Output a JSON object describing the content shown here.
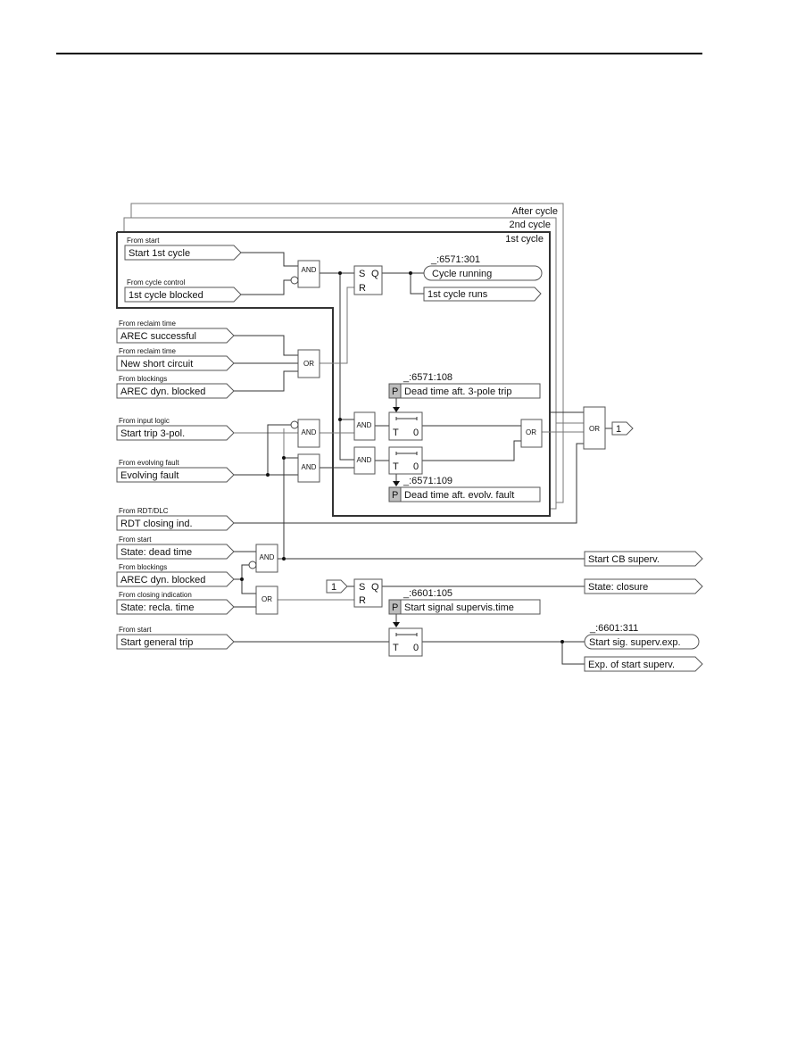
{
  "frames": {
    "after_cycle": "After cycle",
    "second_cycle": "2nd cycle",
    "first_cycle": "1st cycle"
  },
  "inputs": [
    {
      "source": "From start",
      "label": "Start 1st cycle"
    },
    {
      "source": "From cycle control",
      "label": "1st cycle blocked"
    },
    {
      "source": "From reclaim time",
      "label": "AREC successful"
    },
    {
      "source": "From reclaim time",
      "label": "New short circuit"
    },
    {
      "source": "From blockings",
      "label": "AREC dyn. blocked"
    },
    {
      "source": "From input logic",
      "label": "Start trip 3-pol."
    },
    {
      "source": "From evolving fault",
      "label": "Evolving fault"
    },
    {
      "source": "From RDT/DLC",
      "label": "RDT closing ind."
    },
    {
      "source": "From start",
      "label": "State: dead time"
    },
    {
      "source": "From blockings",
      "label": "AREC dyn. blocked"
    },
    {
      "source": "From closing indication",
      "label": "State: recla. time"
    },
    {
      "source": "From start",
      "label": "Start general trip"
    }
  ],
  "gates": {
    "and": "AND",
    "or": "OR",
    "sr_s": "S",
    "sr_q": "Q",
    "sr_r": "R",
    "timer_t": "T",
    "timer_0": "0",
    "param_p": "P",
    "const_one": "1"
  },
  "outputs": {
    "cycle_running": {
      "id": "_:6571:301",
      "label": "Cycle running"
    },
    "first_cycle_runs": "1st cycle runs",
    "or_out": "1",
    "start_cb_superv": "Start CB superv.",
    "state_closure": "State: closure",
    "start_sig_superv_exp": {
      "id": "_:6601:311",
      "label": "Start sig. superv.exp."
    },
    "exp_of_start_superv": "Exp. of start superv."
  },
  "parameters": {
    "dead_time_3pole": {
      "id": "_:6571:108",
      "label": "Dead time aft. 3-pole trip"
    },
    "dead_time_evolv": {
      "id": "_:6571:109",
      "label": "Dead time aft. evolv. fault"
    },
    "start_signal_supervis": {
      "id": "_:6601:105",
      "label": "Start signal supervis.time"
    }
  }
}
